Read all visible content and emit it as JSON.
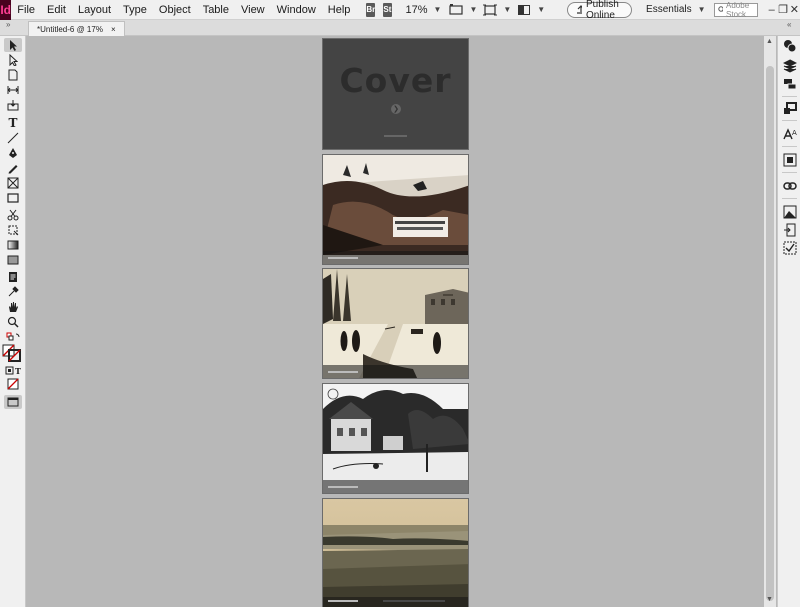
{
  "app": {
    "logo": "Id"
  },
  "menu": {
    "items": [
      "File",
      "Edit",
      "Layout",
      "Type",
      "Object",
      "Table",
      "View",
      "Window",
      "Help"
    ]
  },
  "toolbar_top": {
    "bridge_label": "Br",
    "stock_label": "St",
    "zoom": "17%",
    "publish_label": "Publish Online",
    "workspace": "Essentials",
    "search_placeholder": "Adobe Stock"
  },
  "document_tab": {
    "title": "*Untitled-6 @ 17%",
    "close": "×"
  },
  "cover": {
    "title": "Cover"
  },
  "colors": {
    "cover_bg": "#444444",
    "app_accent": "#ff3f94",
    "app_bg": "#49021f"
  },
  "pages": [
    {
      "name": "cover-page"
    },
    {
      "name": "photo-page-crowd"
    },
    {
      "name": "photo-page-street"
    },
    {
      "name": "photo-page-trees"
    },
    {
      "name": "photo-page-river"
    }
  ]
}
